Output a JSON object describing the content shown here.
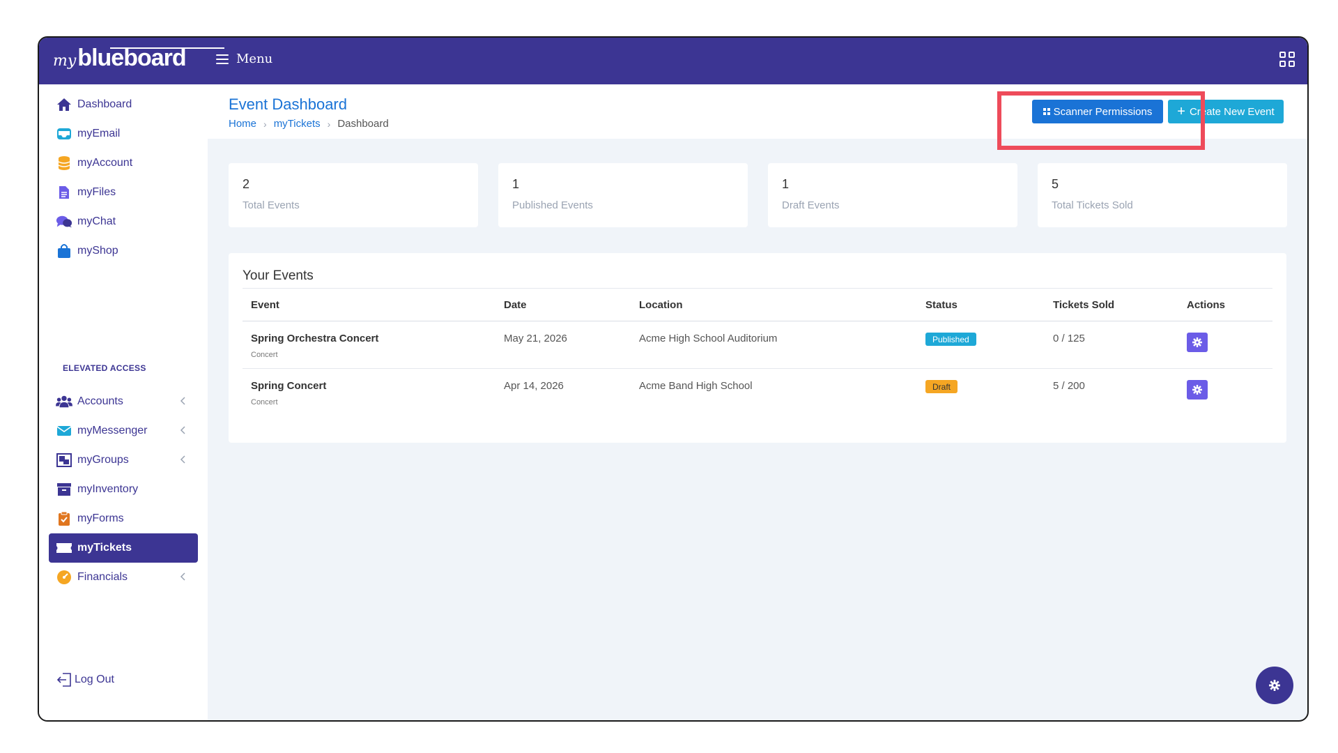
{
  "brand": {
    "logo_my": "my",
    "logo_main": "blueboard"
  },
  "topbar": {
    "menu_label": "Menu"
  },
  "sidebar": {
    "items": [
      {
        "label": "Dashboard"
      },
      {
        "label": "myEmail"
      },
      {
        "label": "myAccount"
      },
      {
        "label": "myFiles"
      },
      {
        "label": "myChat"
      },
      {
        "label": "myShop"
      }
    ],
    "section_label": "ELEVATED ACCESS",
    "elevated_items": [
      {
        "label": "Accounts"
      },
      {
        "label": "myMessenger"
      },
      {
        "label": "myGroups"
      },
      {
        "label": "myInventory"
      },
      {
        "label": "myForms"
      },
      {
        "label": "myTickets",
        "active": true
      },
      {
        "label": "Financials"
      }
    ],
    "logout_label": "Log Out"
  },
  "page": {
    "title": "Event Dashboard",
    "breadcrumb": [
      "Home",
      "myTickets",
      "Dashboard"
    ],
    "scanner_button": "Scanner Permissions",
    "create_button": "Create New Event"
  },
  "stats": [
    {
      "value": "2",
      "label": "Total Events"
    },
    {
      "value": "1",
      "label": "Published Events"
    },
    {
      "value": "1",
      "label": "Draft Events"
    },
    {
      "value": "5",
      "label": "Total Tickets Sold"
    }
  ],
  "events": {
    "title": "Your Events",
    "columns": [
      "Event",
      "Date",
      "Location",
      "Status",
      "Tickets Sold",
      "Actions"
    ],
    "rows": [
      {
        "name": "Spring Orchestra Concert",
        "category": "Concert",
        "date": "May 21, 2026",
        "location": "Acme High School Auditorium",
        "status": "Published",
        "tickets": "0 / 125"
      },
      {
        "name": "Spring Concert",
        "category": "Concert",
        "date": "Apr 14, 2026",
        "location": "Acme Band High School",
        "status": "Draft",
        "tickets": "5 / 200"
      }
    ]
  },
  "colors": {
    "primary": "#3c3593",
    "link": "#1a73d6",
    "cyan": "#1ea8d7",
    "draft": "#f5a623",
    "action": "#6b5ce7",
    "highlight": "#ee4b5a"
  }
}
